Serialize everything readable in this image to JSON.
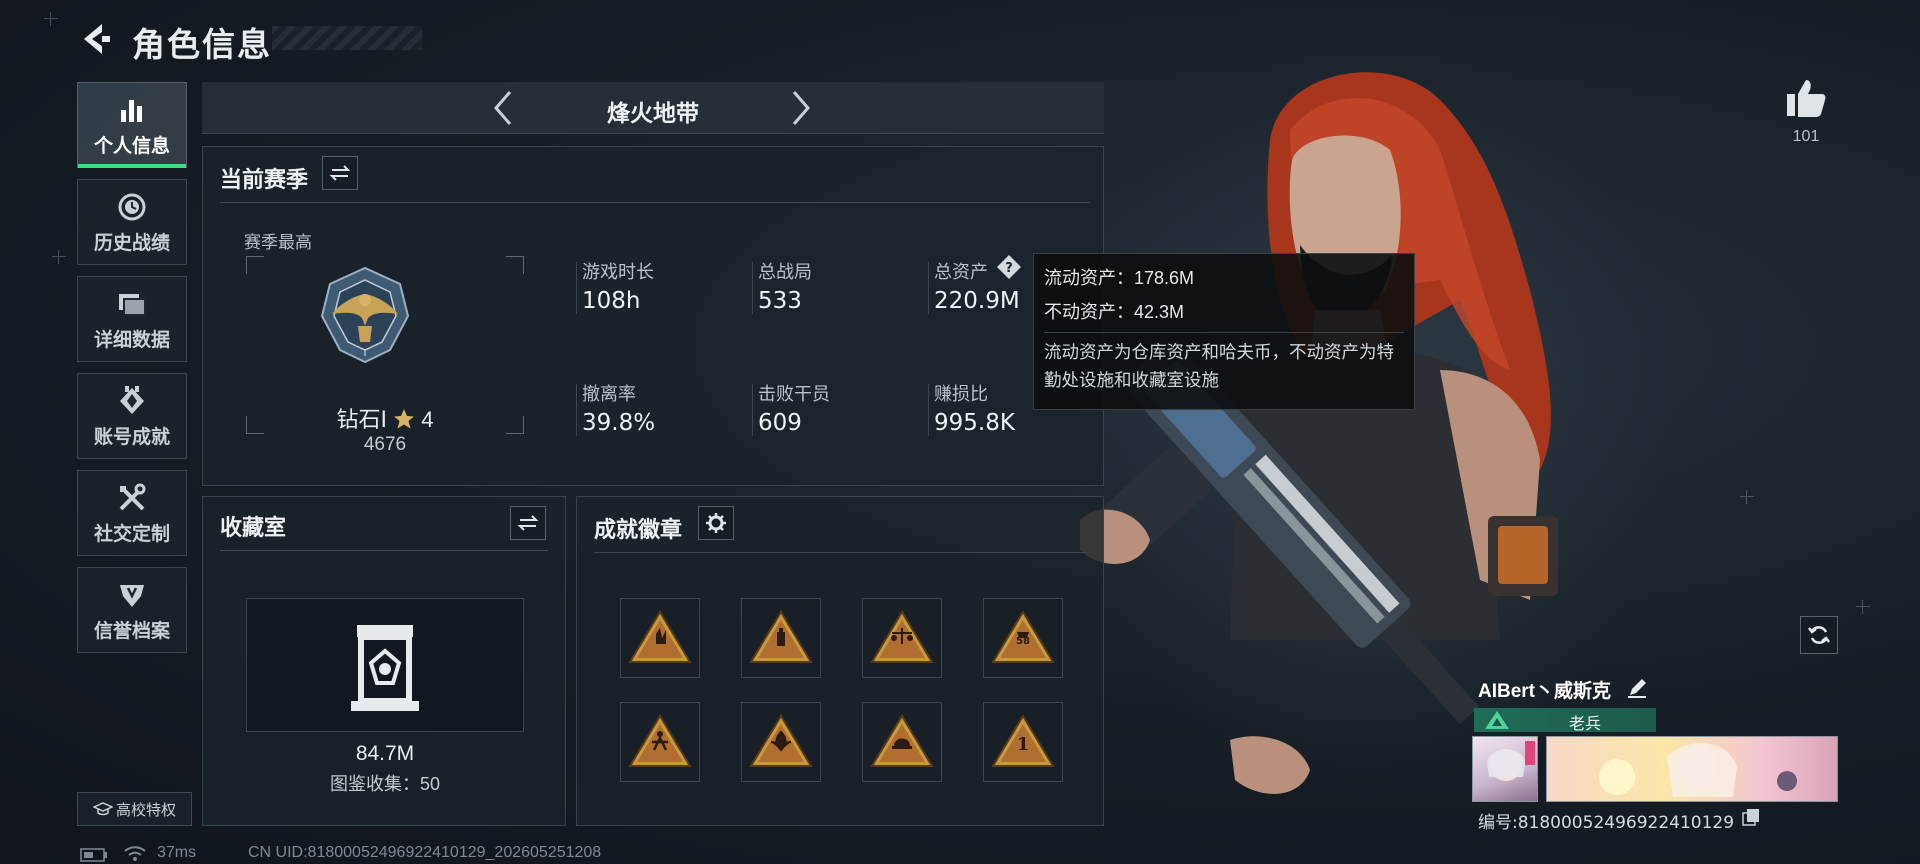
{
  "header": {
    "title": "角色信息"
  },
  "nav": {
    "items": [
      {
        "label": "个人信息",
        "icon": "bar-chart-icon",
        "active": true
      },
      {
        "label": "历史战绩",
        "icon": "history-clock-icon",
        "active": false
      },
      {
        "label": "详细数据",
        "icon": "folder-icon",
        "active": false
      },
      {
        "label": "账号成就",
        "icon": "achievement-icon",
        "active": false
      },
      {
        "label": "社交定制",
        "icon": "tools-icon",
        "active": false
      },
      {
        "label": "信誉档案",
        "icon": "shield-wings-icon",
        "active": false
      }
    ],
    "campus_label": "高校特权"
  },
  "mode": {
    "title": "烽火地带"
  },
  "season": {
    "title": "当前赛季",
    "best_label": "赛季最高",
    "rank_name": "钻石Ⅰ",
    "rank_stars": "4",
    "rank_score": "4676",
    "stats": [
      {
        "label": "游戏时长",
        "value": "108h"
      },
      {
        "label": "总战局",
        "value": "533"
      },
      {
        "label": "总资产",
        "value": "220.9M"
      },
      {
        "label": "撤离率",
        "value": "39.8%"
      },
      {
        "label": "击败干员",
        "value": "609"
      },
      {
        "label": "赚损比",
        "value": "995.8K"
      }
    ]
  },
  "tooltip": {
    "liquid": "流动资产：178.6M",
    "fixed": "不动资产：42.3M",
    "desc": "流动资产为仓库资产和哈夫币，不动资产为特勤处设施和收藏室设施"
  },
  "collection": {
    "title": "收藏室",
    "value": "84.7M",
    "count_text": "图鉴收集：50"
  },
  "achievements": {
    "title": "成就徽章",
    "badges": [
      "badge-hand-icon",
      "badge-bottle-icon",
      "badge-scale-icon",
      "badge-58-icon",
      "badge-figure-icon",
      "badge-lotus-icon",
      "badge-helmet-icon",
      "badge-number-one-icon"
    ],
    "accent": "#c89a3e"
  },
  "profile": {
    "likes": "101",
    "name": "AIBert丶威斯克",
    "rank_title": "老兵",
    "id_text": "编号:81800052496922410129"
  },
  "status_bar": {
    "ping": "37ms",
    "uid": "CN UID:81800052496922410129_202605251208"
  },
  "colors": {
    "active_green": "#39e07d",
    "rank_teal": "#1f6c57",
    "hair": "#b43a1e"
  }
}
